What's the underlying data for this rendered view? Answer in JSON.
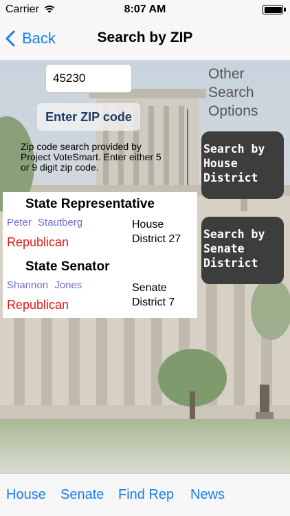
{
  "status_bar": {
    "carrier": "Carrier",
    "time": "8:07 AM",
    "wifi_icon": "wifi-icon",
    "battery_icon": "battery-icon"
  },
  "nav": {
    "back_label": "Back",
    "back_icon": "chevron-left-icon",
    "title": "Search by ZIP",
    "accent_color": "#1a7cf5"
  },
  "zip_search": {
    "input_value": "45230",
    "button_label": "Enter ZIP code",
    "info_text": "Zip code search provided by Project VoteSmart.  Enter either 5 or 9 digit zip code."
  },
  "other_options": {
    "heading": "Other Search Options",
    "house_button_label": "Search by House District",
    "senate_button_label": "Search by Senate District"
  },
  "results": {
    "representative": {
      "office": "State Representative",
      "name": "Peter  Stautberg",
      "party": "Republican",
      "district": "House District 27"
    },
    "senator": {
      "office": "State Senator",
      "name": "Shannon  Jones",
      "party": "Republican",
      "district": "Senate District 7"
    },
    "name_color": "#6b6fcf",
    "party_color": "#e01b1b"
  },
  "tabs": [
    "House",
    "Senate",
    "Find Rep",
    "News"
  ]
}
